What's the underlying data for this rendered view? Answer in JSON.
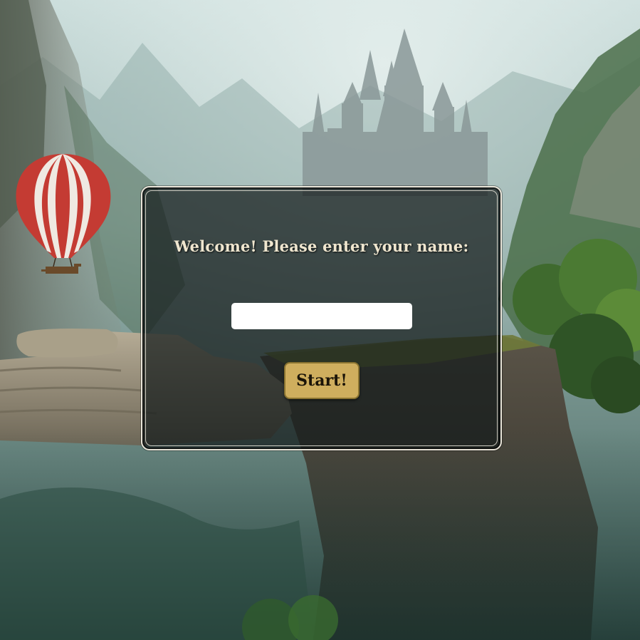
{
  "background": {
    "scene_icon": "fantasy-cliff-castle-balloon-background",
    "sky_color": "#b9cfcf",
    "accent_color": "#cfae5e"
  },
  "welcome_dialog": {
    "prompt": "Welcome! Please enter your name:",
    "name_input": {
      "value": "",
      "placeholder": ""
    },
    "start_label": "Start!"
  }
}
